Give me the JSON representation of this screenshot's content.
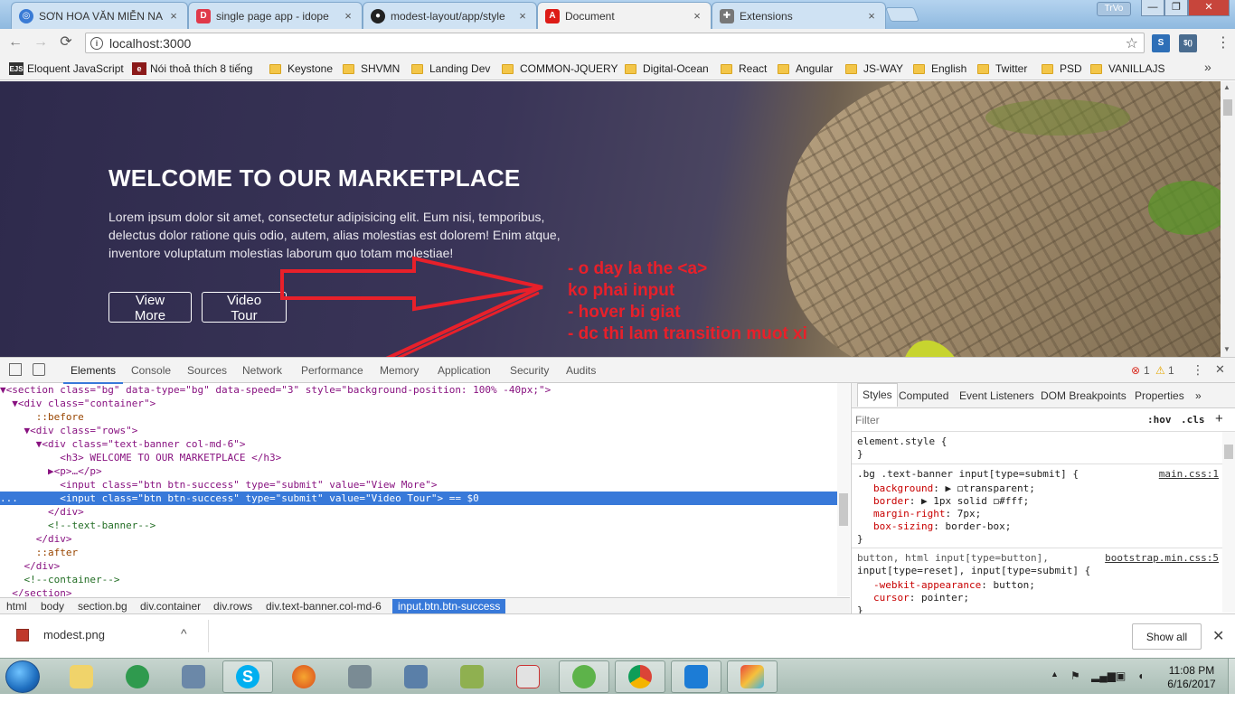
{
  "browser": {
    "tabs": [
      {
        "title": "SƠN HOA VĂN MIỄN NA",
        "icon": "globe-icon",
        "color": "#3a7bd5"
      },
      {
        "title": "single page app - idope",
        "icon": "idope-icon",
        "color": "#e0394a"
      },
      {
        "title": "modest-layout/app/style",
        "icon": "github-icon",
        "color": "#222222"
      },
      {
        "title": "Document",
        "icon": "angular-icon",
        "color": "#dd1b16"
      },
      {
        "title": "Extensions",
        "icon": "puzzle-icon",
        "color": "#777777"
      }
    ],
    "close_glyph": "×",
    "user_badge": "TrVo",
    "window_controls": {
      "minimize": "—",
      "maximize": "❐",
      "close": "✕"
    },
    "url": "localhost:3000",
    "back": "←",
    "forward": "→",
    "reload": "⟳",
    "star": "☆",
    "info_glyph": "i",
    "ext1": "S",
    "ext2": "$()",
    "menu": "⋮"
  },
  "bookmarks": [
    {
      "label": "Eloquent JavaScript",
      "type": "site",
      "badge": "EJS",
      "color": "#333333"
    },
    {
      "label": "Nói thoả thích 8 tiếng",
      "type": "site",
      "badge": "e",
      "color": "#8b1a1a"
    },
    {
      "label": "Keystone",
      "type": "folder"
    },
    {
      "label": "SHVMN",
      "type": "folder"
    },
    {
      "label": "Landing Dev",
      "type": "folder"
    },
    {
      "label": "COMMON-JQUERY",
      "type": "folder"
    },
    {
      "label": "Digital-Ocean",
      "type": "folder"
    },
    {
      "label": "React",
      "type": "folder"
    },
    {
      "label": "Angular",
      "type": "folder"
    },
    {
      "label": "JS-WAY",
      "type": "folder"
    },
    {
      "label": "English",
      "type": "folder"
    },
    {
      "label": "Twitter",
      "type": "folder"
    },
    {
      "label": "PSD",
      "type": "folder"
    },
    {
      "label": "VANILLAJS",
      "type": "folder"
    }
  ],
  "bookmarks_more": "»",
  "page": {
    "title": "WELCOME TO OUR MARKETPLACE",
    "text": "Lorem ipsum dolor sit amet, consectetur adipisicing elit. Eum nisi, temporibus, delectus dolor ratione quis odio, autem, alias molestias est dolorem! Enim atque, inventore voluptatum molestias laborum quo totam molestiae!",
    "btn_view_more": "View More",
    "btn_video_tour": "Video Tour",
    "annotation": "- o day la the <a>\nko phai input\n- hover bi giat\n- dc thi lam transition muot xi",
    "annotation_color": "#e8202a"
  },
  "devtools": {
    "tabs": [
      "Elements",
      "Console",
      "Sources",
      "Network",
      "Performance",
      "Memory",
      "Application",
      "Security",
      "Audits"
    ],
    "errors": "1",
    "warnings": "1",
    "error_glyph": "⊗",
    "warning_glyph": "⚠",
    "close": "✕",
    "more": "⋮",
    "dom_lines": [
      {
        "text": "▼<section class=\"bg\" data-type=\"bg\" data-speed=\"3\" style=\"background-position: 100% -40px;\">",
        "kind": "tag"
      },
      {
        "text": "  ▼<div class=\"container\">",
        "kind": "tag"
      },
      {
        "text": "      ::before",
        "kind": "pseudo"
      },
      {
        "text": "    ▼<div class=\"rows\">",
        "kind": "tag"
      },
      {
        "text": "      ▼<div class=\"text-banner col-md-6\">",
        "kind": "tag"
      },
      {
        "text": "          <h3> WELCOME TO OUR MARKETPLACE </h3>",
        "kind": "tag"
      },
      {
        "text": "        ▶<p>…</p>",
        "kind": "tag"
      },
      {
        "text": "          <input class=\"btn btn-success\" type=\"submit\" value=\"View More\">",
        "kind": "tag"
      },
      {
        "text": "...       <input class=\"btn btn-success\" type=\"submit\" value=\"Video Tour\"> == $0",
        "kind": "selected"
      },
      {
        "text": "        </div>",
        "kind": "tag"
      },
      {
        "text": "        <!--text-banner-->",
        "kind": "comment"
      },
      {
        "text": "      </div>",
        "kind": "tag"
      },
      {
        "text": "      ::after",
        "kind": "pseudo"
      },
      {
        "text": "    </div>",
        "kind": "tag"
      },
      {
        "text": "    <!--container-->",
        "kind": "comment"
      },
      {
        "text": "  </section>",
        "kind": "tag"
      }
    ],
    "breadcrumbs": [
      "html",
      "body",
      "section.bg",
      "div.container",
      "div.rows",
      "div.text-banner.col-md-6",
      "input.btn.btn-success"
    ],
    "styles_tabs": [
      "Styles",
      "Computed",
      "Event Listeners",
      "DOM Breakpoints",
      "Properties"
    ],
    "styles_more": "»",
    "filter_placeholder": "Filter",
    "hov": ":hov",
    "cls": ".cls",
    "plus": "+",
    "element_style_open": "element.style {",
    "brace_close": "}",
    "rule1_selector": ".bg .text-banner input[type=submit] {",
    "rule1_source": "main.css:1",
    "rule1_props": [
      {
        "name": "background",
        "value": "▶ ◻transparent;"
      },
      {
        "name": "border",
        "value": "▶ 1px solid ◻#fff;"
      },
      {
        "name": "margin-right",
        "value": "7px;"
      },
      {
        "name": "box-sizing",
        "value": "border-box;"
      }
    ],
    "rule2_selector": "button, html input[type=button],",
    "rule2_selector2": "input[type=reset], input[type=submit] {",
    "rule2_source": "bootstrap.min.css:5",
    "rule2_props": [
      {
        "name": "-webkit-appearance",
        "value": "button;"
      },
      {
        "name": "cursor",
        "value": "pointer;"
      }
    ]
  },
  "download": {
    "filename": "modest.png",
    "chevron": "^",
    "show_all": "Show all",
    "close": "✕"
  },
  "taskbar": {
    "apps": [
      "windows-explorer",
      "rocket-app",
      "remote-desktop",
      "skype",
      "firefox",
      "filezilla",
      "network-tool",
      "chart-app",
      "unikey",
      "clover-app",
      "chrome",
      "vscode",
      "tool-app"
    ],
    "time": "11:08 PM",
    "date": "6/16/2017",
    "tray_arrow": "▲"
  }
}
